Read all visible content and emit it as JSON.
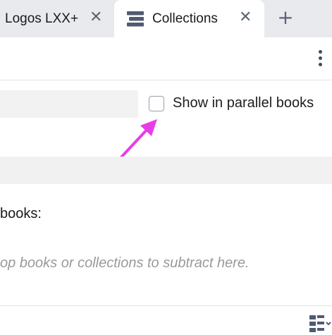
{
  "tabs": [
    {
      "label": "Logos LXX+",
      "close_icon": "close-icon",
      "active": false
    },
    {
      "label": "Collections",
      "icon": "collections-icon",
      "close_icon": "close-icon",
      "active": true
    }
  ],
  "tabbar": {
    "add_tab_icon": "plus-icon"
  },
  "toolbar": {
    "more_icon": "more-vertical-icon"
  },
  "collection": {
    "show_parallel_label": "Show in parallel books",
    "show_parallel_checked": false,
    "subtract_label": "books:",
    "subtract_drop_hint": "op books or collections to subtract here."
  },
  "footer": {
    "view_icon": "list-view-icon"
  },
  "colors": {
    "tab_bar": "#e9eaed",
    "icon": "#5b6577",
    "annotation_arrow": "#e83ce8"
  }
}
